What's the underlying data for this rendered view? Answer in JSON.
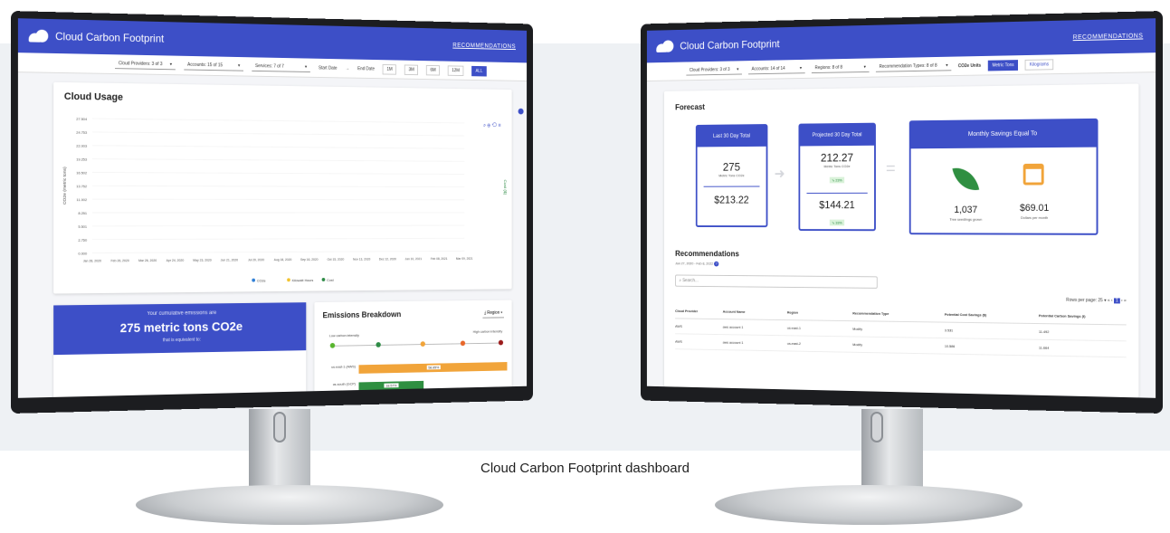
{
  "caption": "Cloud Carbon Footprint dashboard",
  "left_app": {
    "title": "Cloud Carbon Footprint",
    "nav_link": "RECOMMENDATIONS",
    "filters": [
      "Cloud Providers: 3 of 3",
      "Accounts: 15 of 15",
      "Services: 7 of 7"
    ],
    "start_date": "Start Date",
    "end_date": "End Date",
    "range_buttons": [
      "1M",
      "3M",
      "6M",
      "12M",
      "ALL"
    ],
    "cloud_usage_title": "Cloud Usage",
    "ylabel_left": "CO2e (metric tons)",
    "ylabel_right": "Cost ($)",
    "y_ticks": [
      "27.504",
      "24.753",
      "22.003",
      "19.253",
      "16.502",
      "13.752",
      "11.002",
      "8.251",
      "5.501",
      "2.750",
      "0.000"
    ],
    "x_ticks": [
      "Jan 28, 2020",
      "Feb 26, 2020",
      "Mar 26, 2020",
      "Apr 24, 2020",
      "May 23, 2020",
      "Jun 21, 2020",
      "Jul 20, 2020",
      "Aug 18, 2020",
      "Sep 16, 2020",
      "Oct 15, 2020",
      "Nov 13, 2020",
      "Dec 12, 2020",
      "Jan 10, 2021",
      "Feb 08, 2021",
      "Mar 09, 2021"
    ],
    "legend": [
      "CO2e",
      "Kilowatt Hours",
      "Cost"
    ],
    "emissions_line1": "Your cumulative emissions are",
    "emissions_value": "275 metric tons CO2e",
    "emissions_line3": "that is equivalent to:",
    "breakdown_title": "Emissions Breakdown",
    "breakdown_select": "Region",
    "low_label": "Low carbon intensity",
    "high_label": "High carbon intensity",
    "bars": [
      {
        "label": "us-east-1 (AWS)",
        "value": "58.85%"
      },
      {
        "label": "us-south (GCP)",
        "value": "18.57%"
      }
    ],
    "colors": {
      "primary": "#3d4fc7",
      "co2e": "#2f7fd6",
      "kwh": "#f2c32e",
      "cost": "#2e8b46",
      "bar_orange": "#f1a43a",
      "bar_green": "#2f8f41"
    }
  },
  "right_app": {
    "title": "Cloud Carbon Footprint",
    "nav_link": "RECOMMENDATIONS",
    "filters": [
      "Cloud Providers: 3 of 3",
      "Accounts: 14 of 14",
      "Regions: 8 of 8",
      "Recommendation Types: 8 of 8"
    ],
    "co2e_units_label": "CO2e Units",
    "unit_buttons": [
      "Metric Tons",
      "Kilograms"
    ],
    "forecast_title": "Forecast",
    "last30_title": "Last 30 Day Total",
    "last30_co2": "275",
    "last30_unit": "Metric Tons CO2e",
    "last30_cost": "$213.22",
    "proj30_title": "Projected 30 Day Total",
    "proj30_co2": "212.27",
    "proj30_unit": "Metric Tons CO2e",
    "proj30_pct1": "⇘ 23%",
    "proj30_cost": "$144.21",
    "proj30_pct2": "⇘ 33%",
    "savings_title": "Monthly Savings Equal To",
    "trees_value": "1,037",
    "trees_label": "Tree seedlings grown",
    "dollars_value": "$69.01",
    "dollars_label": "Dollars per month",
    "rec_title": "Recommendations",
    "rec_range": "Jan 27, 2020 - Feb 8, 2022",
    "search_placeholder": "Search...",
    "rows_per_page": "Rows per page: 25 ▾",
    "columns": [
      "Cloud Provider",
      "Account Name",
      "Region",
      "Recommendation Type",
      "Potential Cost Savings ($)",
      "Potential Carbon Savings (t)"
    ],
    "rows": [
      [
        "AWS",
        "aws account 1",
        "us-east-1",
        "Modify",
        "3.531",
        "11.492"
      ],
      [
        "AWS",
        "aws account 1",
        "us-east-2",
        "Modify",
        "10.586",
        "11.664"
      ]
    ]
  }
}
